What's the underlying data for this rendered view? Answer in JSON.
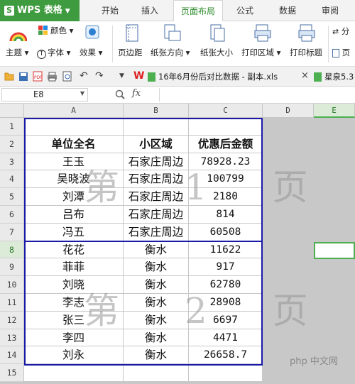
{
  "app": {
    "logo": "WPS 表格"
  },
  "tabs": [
    {
      "label": "开始"
    },
    {
      "label": "插入"
    },
    {
      "label": "页面布局",
      "active": true
    },
    {
      "label": "公式"
    },
    {
      "label": "数据"
    },
    {
      "label": "审阅"
    }
  ],
  "ribbon": {
    "color_label": "颜色",
    "theme_label": "主题",
    "font_label": "字体",
    "effect_label": "效果",
    "margins_label": "页边距",
    "orientation_label": "纸张方向",
    "size_label": "纸张大小",
    "print_area_label": "打印区域",
    "print_titles_label": "打印标题",
    "page_label": "页",
    "divider_label": "分"
  },
  "quick_access": {
    "doc_tab_1": "16年6月份后对比数据 - 副本.xls",
    "doc_tab_2": "星泉5.3"
  },
  "formula_bar": {
    "cell_ref": "E8",
    "fx_label": "fx",
    "value": ""
  },
  "columns": [
    "A",
    "B",
    "C",
    "D",
    "E"
  ],
  "rows": [
    {
      "num": "1",
      "cells": [
        "",
        "",
        ""
      ]
    },
    {
      "num": "2",
      "cells": [
        "单位全名",
        "小区域",
        "优惠后金额"
      ]
    },
    {
      "num": "3",
      "cells": [
        "王玉",
        "石家庄周边",
        "78928.23"
      ]
    },
    {
      "num": "4",
      "cells": [
        "吴晓波",
        "石家庄周边",
        "100799"
      ]
    },
    {
      "num": "5",
      "cells": [
        "刘潭",
        "石家庄周边",
        "2180"
      ]
    },
    {
      "num": "6",
      "cells": [
        "吕布",
        "石家庄周边",
        "814"
      ]
    },
    {
      "num": "7",
      "cells": [
        "冯五",
        "石家庄周边",
        "60508"
      ]
    },
    {
      "num": "8",
      "cells": [
        "花花",
        "衡水",
        "11622"
      ]
    },
    {
      "num": "9",
      "cells": [
        "菲菲",
        "衡水",
        "917"
      ]
    },
    {
      "num": "10",
      "cells": [
        "刘晓",
        "衡水",
        "62780"
      ]
    },
    {
      "num": "11",
      "cells": [
        "李志",
        "衡水",
        "28908"
      ]
    },
    {
      "num": "12",
      "cells": [
        "张三",
        "衡水",
        "6697"
      ]
    },
    {
      "num": "13",
      "cells": [
        "李四",
        "衡水",
        "4471"
      ]
    },
    {
      "num": "14",
      "cells": [
        "刘永",
        "衡水",
        "26658.7"
      ]
    },
    {
      "num": "15",
      "cells": [
        "",
        "",
        ""
      ]
    }
  ],
  "page_watermarks": [
    "第 1 页",
    "第 2 页"
  ],
  "watermark_site": "php 中文网",
  "colors": {
    "accent": "#3f9b3f",
    "page_break": "#1a1aa8",
    "selection": "#4caf50"
  }
}
